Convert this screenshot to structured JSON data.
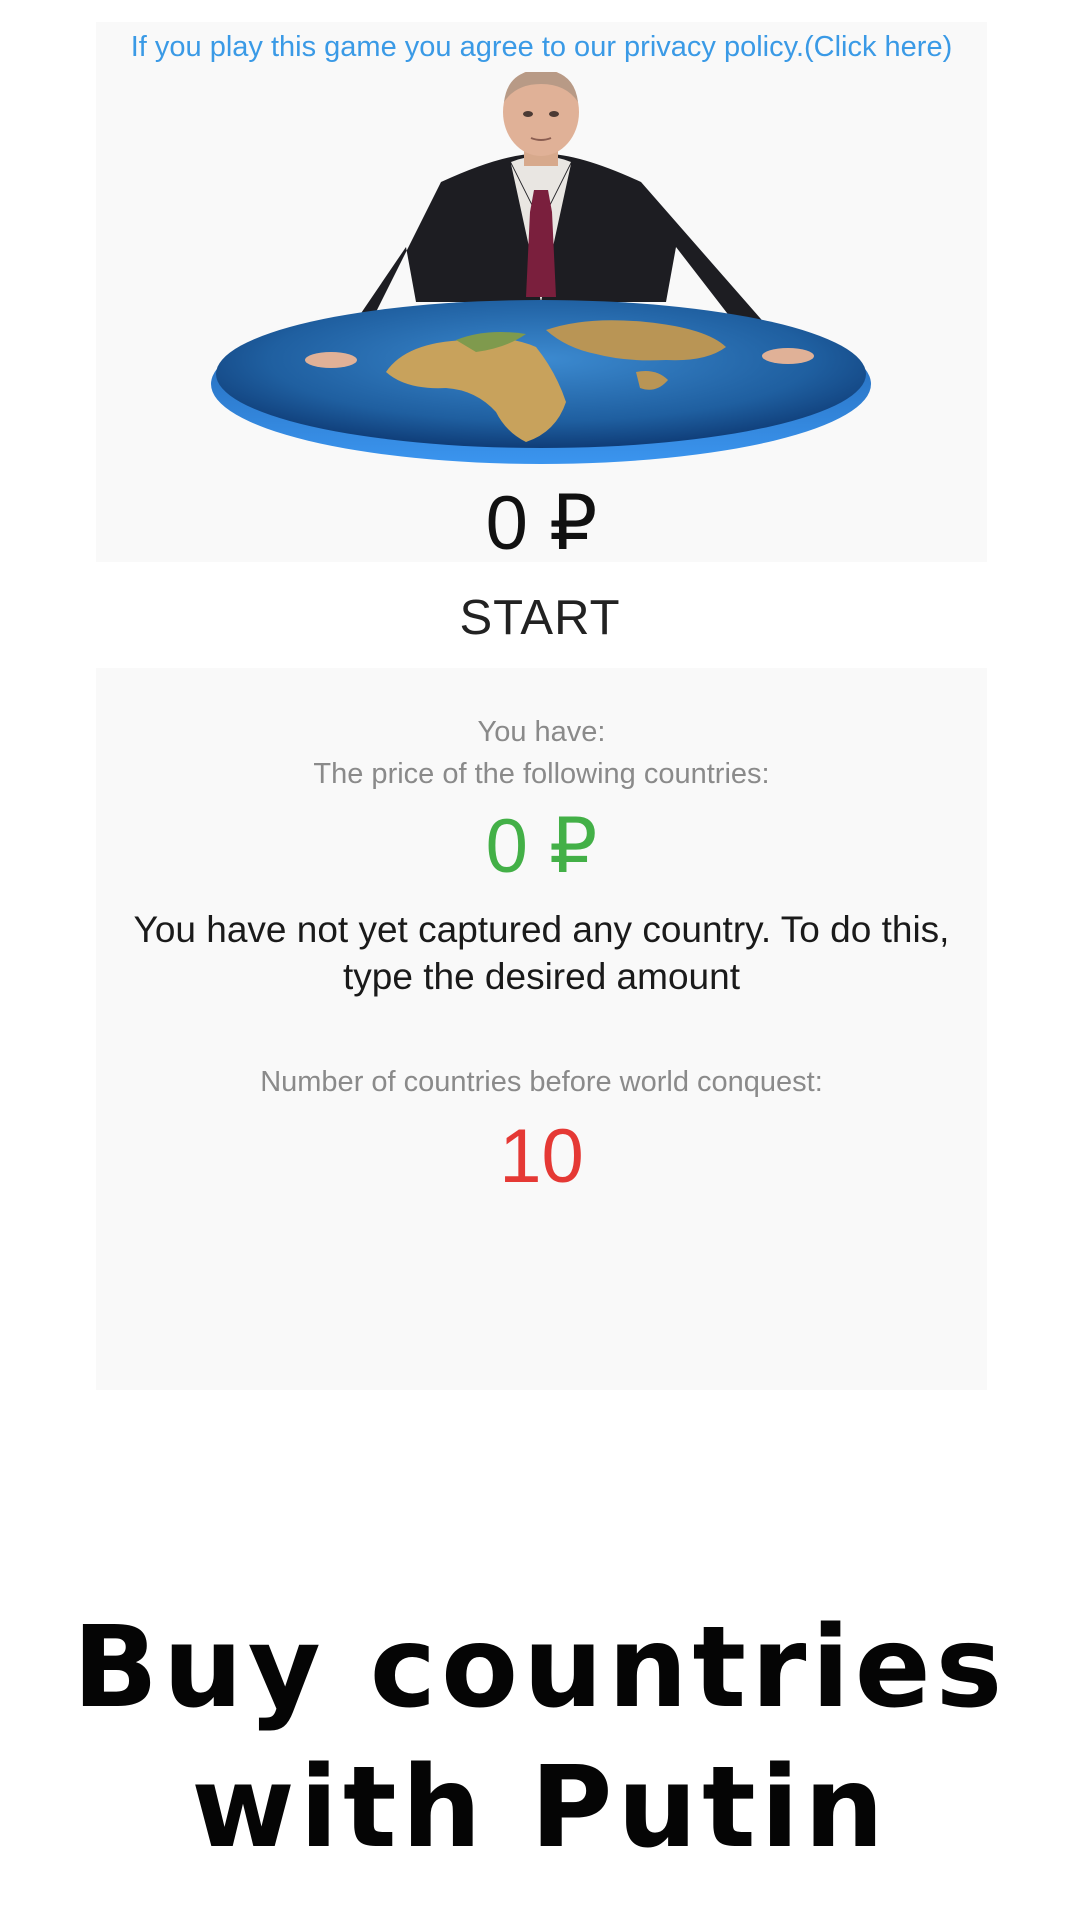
{
  "privacy": {
    "link_text": "If you play this game you agree to our privacy policy.(Click here)"
  },
  "hero": {
    "image_name": "putin-with-globe",
    "colors": {
      "suit": "#1d1d22",
      "tie": "#7a1f3d",
      "ocean": "#1f5fa0",
      "land": "#c8a25c"
    }
  },
  "balance": {
    "amount_text": "0 ₽"
  },
  "start_button": {
    "label": "START"
  },
  "stats": {
    "you_have_label": "You have:",
    "price_label": "The price of the following countries:",
    "price_value": "0 ₽",
    "message": "You have not yet captured any country. To do this, type the desired amount",
    "conquest_label": "Number of countries before world conquest:",
    "conquest_value": "10"
  },
  "promo": {
    "line1": "Buy countries",
    "line2": "with Putin"
  },
  "colors": {
    "link": "#3a9ae6",
    "price": "#43b047",
    "conquest": "#e53935",
    "panel_bg": "#f9f9f9"
  }
}
